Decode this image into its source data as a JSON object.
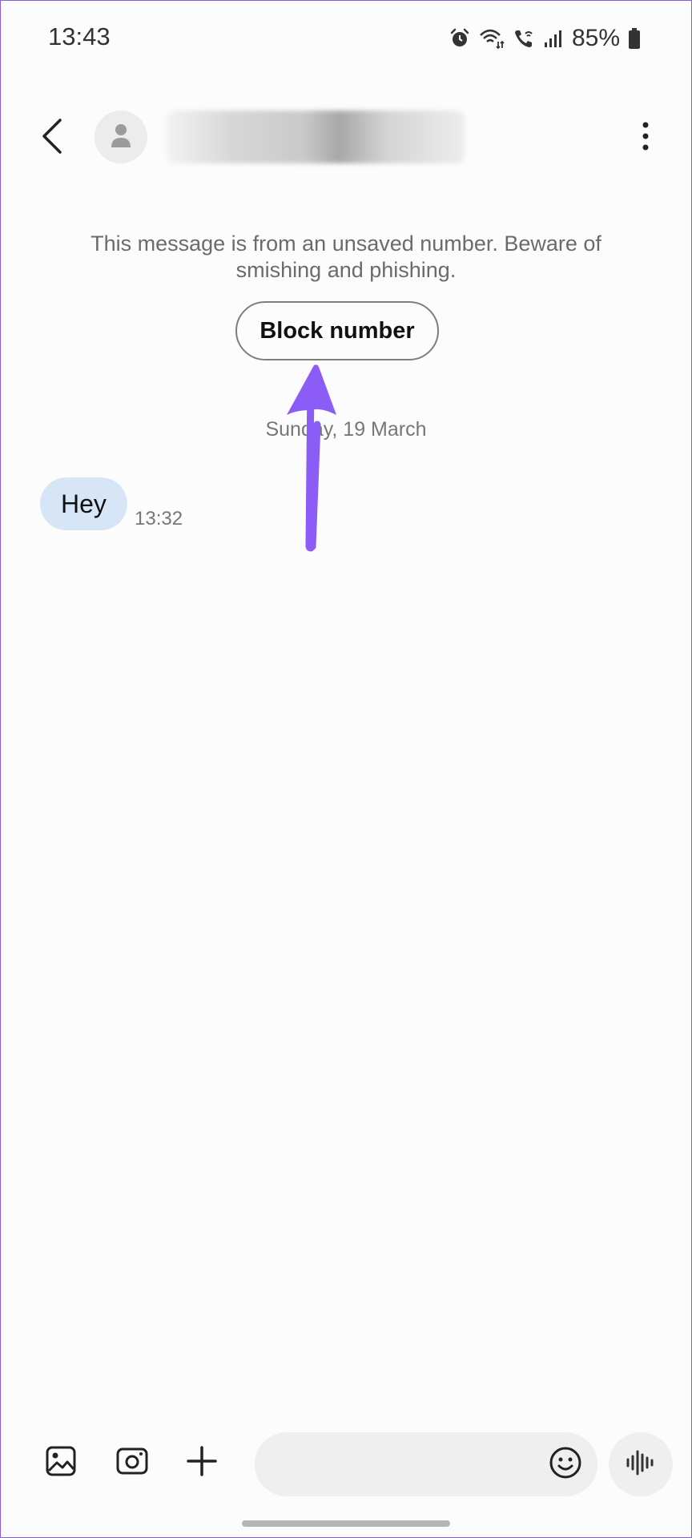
{
  "status_bar": {
    "time": "13:43",
    "battery": "85%",
    "icons": [
      "alarm-icon",
      "wifi-icon",
      "wifi-call-icon",
      "signal-icon",
      "battery-icon"
    ]
  },
  "header": {
    "contact_name": "+•• ••••• •••••",
    "icons": [
      "back-icon",
      "avatar-icon",
      "more-options-icon"
    ]
  },
  "warning": {
    "text": "This message is from an unsaved number. Beware of smishing and phishing.",
    "block_label": "Block number"
  },
  "conversation": {
    "date": "Sunday, 19 March",
    "messages": [
      {
        "text": "Hey",
        "time": "13:32"
      }
    ]
  },
  "composer": {
    "placeholder": "",
    "icons": [
      "gallery-icon",
      "camera-icon",
      "add-icon",
      "emoji-icon",
      "voice-icon"
    ]
  },
  "colors": {
    "accent_arrow": "#8b5cf6",
    "bubble": "#d7e6f7",
    "background": "#fcfcfc"
  }
}
